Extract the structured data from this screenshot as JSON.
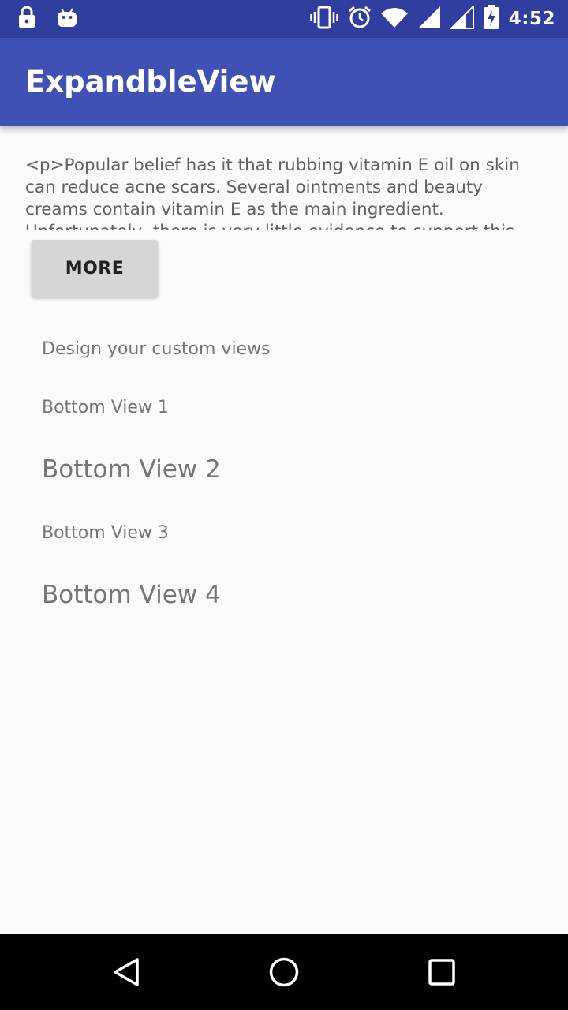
{
  "status_bar": {
    "time": "4:52",
    "icons": [
      "lock-icon",
      "android-icon",
      "vibrate-icon",
      "alarm-icon",
      "wifi-icon",
      "signal-icon",
      "signal-icon",
      "battery-charging-icon"
    ]
  },
  "app_bar": {
    "title": "ExpandbleView",
    "color": "#3f51b5"
  },
  "content": {
    "body_text": "<p>Popular belief has it that rubbing vitamin E oil on skin can reduce acne scars. Several ointments and beauty creams contain vitamin E as the main ingredient. Unfortunately, there is very little evidence to support this claim.</p>",
    "more_label": "MORE",
    "custom_title": "Design your custom views",
    "bottom_views": [
      "Bottom View 1",
      "Bottom View 2",
      "Bottom View 3",
      "Bottom View 4"
    ]
  },
  "nav_bar": {
    "icons": [
      "back-icon",
      "home-icon",
      "recents-icon"
    ]
  }
}
